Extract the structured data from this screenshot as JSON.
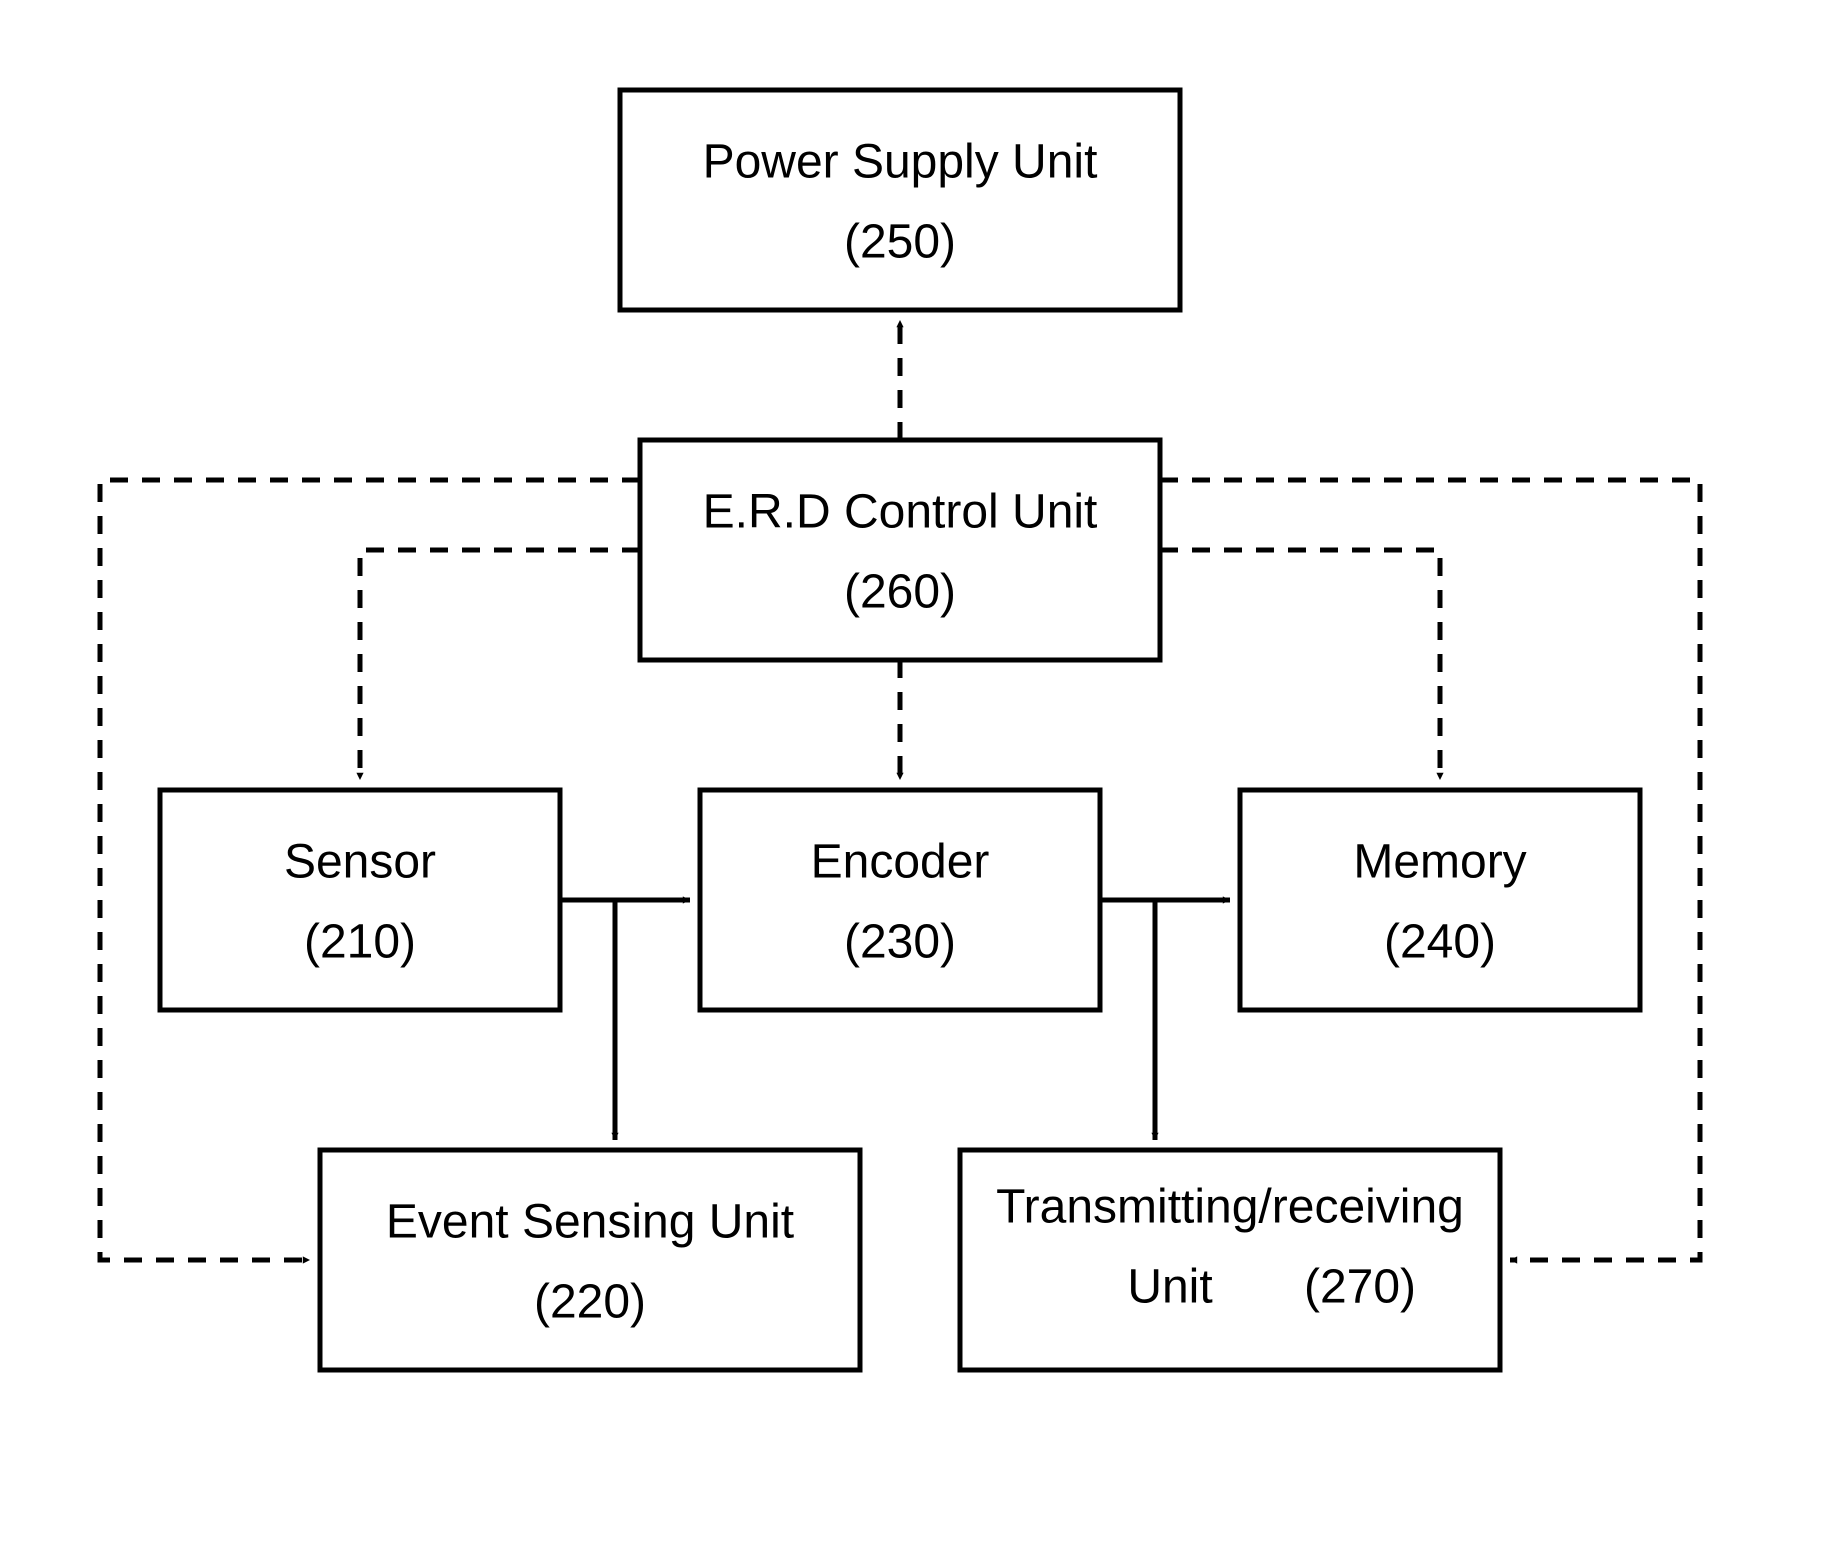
{
  "boxes": {
    "power": {
      "title": "Power Supply Unit",
      "num": "(250)"
    },
    "control": {
      "title": "E.R.D Control Unit",
      "num": "(260)"
    },
    "sensor": {
      "title": "Sensor",
      "num": "(210)"
    },
    "encoder": {
      "title": "Encoder",
      "num": "(230)"
    },
    "memory": {
      "title": "Memory",
      "num": "(240)"
    },
    "event": {
      "title": "Event Sensing Unit",
      "num": "(220)"
    },
    "txrx": {
      "l1": "Transmitting/receiving",
      "l2": "Unit",
      "num": "(270)"
    }
  }
}
